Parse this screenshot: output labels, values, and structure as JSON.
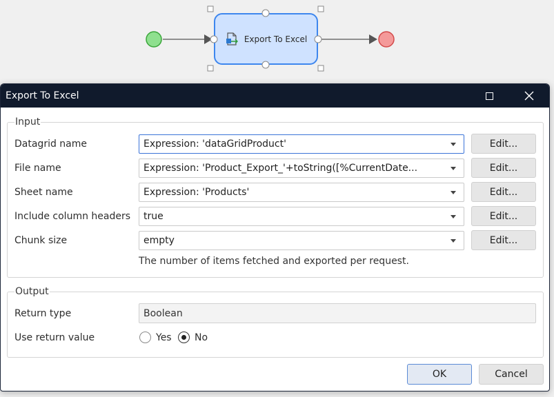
{
  "flow": {
    "activity_label": "Export To Excel",
    "icons": {
      "activity": "export-excel-icon",
      "start": "start-event",
      "end": "end-event"
    },
    "colors": {
      "start": "#8fe08f",
      "end": "#f49a9a",
      "activity_fill": "#cfe2ff",
      "activity_border": "#3d86ee"
    }
  },
  "dialog": {
    "title": "Export To Excel",
    "maximize_icon": "maximize-icon",
    "close_icon": "close-icon",
    "input": {
      "label": "Input",
      "rows": [
        {
          "label": "Datagrid name",
          "value": "Expression: 'dataGridProduct'",
          "button": "Edit..."
        },
        {
          "label": "File name",
          "value": "Expression: 'Product_Export_'+toString([%CurrentDate...",
          "button": "Edit..."
        },
        {
          "label": "Sheet name",
          "value": "Expression: 'Products'",
          "button": "Edit..."
        },
        {
          "label": "Include column headers",
          "value": "true",
          "button": "Edit..."
        },
        {
          "label": "Chunk size",
          "value": "empty",
          "button": "Edit..."
        }
      ],
      "hint": "The number of items fetched and exported per request."
    },
    "output": {
      "label": "Output",
      "return_type_label": "Return type",
      "return_type_value": "Boolean",
      "use_return_label": "Use return value",
      "options": [
        {
          "label": "Yes",
          "selected": false
        },
        {
          "label": "No",
          "selected": true
        }
      ]
    },
    "ok_label": "OK",
    "cancel_label": "Cancel",
    "colors": {
      "titlebar": "#101a2c",
      "accent": "#3a73d8"
    }
  }
}
